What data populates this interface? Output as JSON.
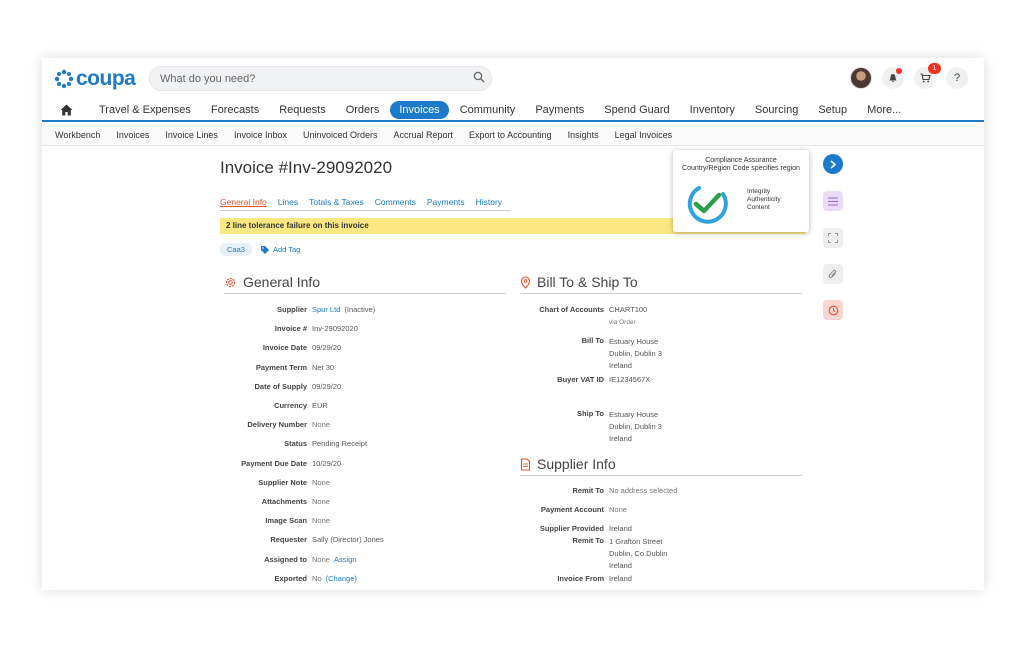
{
  "brand": {
    "name": "coupa",
    "color": "#1b7ac9"
  },
  "search": {
    "placeholder": "What do you need?"
  },
  "header": {
    "cart_badge": "1",
    "help": "?"
  },
  "main_nav": [
    "Travel & Expenses",
    "Forecasts",
    "Requests",
    "Orders",
    "Invoices",
    "Community",
    "Payments",
    "Spend Guard",
    "Inventory",
    "Sourcing",
    "Setup",
    "More..."
  ],
  "main_nav_active": "Invoices",
  "sub_nav": [
    "Workbench",
    "Invoices",
    "Invoice Lines",
    "Invoice Inbox",
    "Uninvoiced Orders",
    "Accrual Report",
    "Export to Accounting",
    "Insights",
    "Legal Invoices"
  ],
  "page": {
    "title": "Invoice #Inv-29092020",
    "tabs": [
      "General Info",
      "Lines",
      "Totals & Taxes",
      "Comments",
      "Payments",
      "History"
    ],
    "warning": "2 line tolerance failure on this invoice",
    "tag": "Caa3",
    "add_tag": "Add Tag"
  },
  "general_info": {
    "heading": "General Info",
    "fields": [
      {
        "label": "Supplier",
        "value": "Spur Ltd",
        "extra": "(Inactive)"
      },
      {
        "label": "Invoice #",
        "value": "Inv-29092020"
      },
      {
        "label": "Invoice Date",
        "value": "09/29/20"
      },
      {
        "label": "Payment Term",
        "value": "Net 30"
      },
      {
        "label": "Date of Supply",
        "value": "09/29/20"
      },
      {
        "label": "Currency",
        "value": "EUR"
      },
      {
        "label": "Delivery Number",
        "value": "None"
      },
      {
        "label": "Status",
        "value": "Pending Receipt"
      },
      {
        "label": "Payment Due Date",
        "value": "10/29/20"
      },
      {
        "label": "Supplier Note",
        "value": "None"
      },
      {
        "label": "Attachments",
        "value": "None"
      },
      {
        "label": "Image Scan",
        "value": "None"
      },
      {
        "label": "Requester",
        "value": "Sally (Director) Jones"
      },
      {
        "label": "Assigned to",
        "value": "None",
        "extra": "Assign"
      },
      {
        "label": "Exported",
        "value": "No",
        "extra": "(Change)"
      }
    ]
  },
  "bill_ship": {
    "heading": "Bill To & Ship To",
    "chart_of_accounts": {
      "label": "Chart of Accounts",
      "value": "CHART100",
      "note": "via Order"
    },
    "bill_to": {
      "label": "Bill To",
      "lines": [
        "Estuary House",
        "Dublin, Dublin 3",
        "Ireland"
      ]
    },
    "buyer_vat": {
      "label": "Buyer VAT ID",
      "value": "IE1234567X"
    },
    "ship_to": {
      "label": "Ship To",
      "lines": [
        "Estuary House",
        "Dublin, Dublin 3",
        "Ireland"
      ]
    }
  },
  "supplier_info": {
    "heading": "Supplier Info",
    "remit_to_1": {
      "label": "Remit To",
      "value": "No address selected"
    },
    "payment_account": {
      "label": "Payment Account",
      "value": "None"
    },
    "supplier_provided": {
      "label": "Supplier Provided",
      "value": "Ireland"
    },
    "remit_to_2": {
      "label": "Remit To",
      "lines": [
        "1 Grafton Street",
        "Dublin, Co.Dublin",
        "Ireland"
      ]
    },
    "invoice_from": {
      "label": "Invoice From",
      "value": "Ireland"
    }
  },
  "compliance_popup": {
    "title": "Compliance Assurance",
    "subtitle": "Country/Region Code specifies region",
    "items": [
      "Integrity",
      "Authenticity",
      "Content"
    ],
    "colors": {
      "check": "#2e9e4a",
      "ring": "#2fa3df"
    }
  }
}
